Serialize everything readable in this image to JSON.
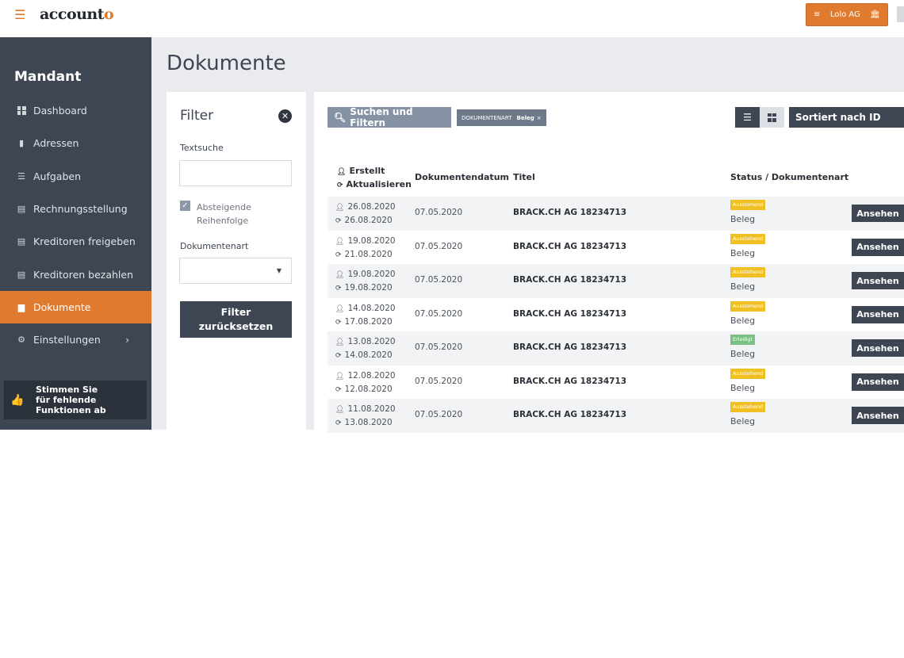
{
  "topbar": {
    "menu_icon": "hamburger-icon",
    "logo_main": "account",
    "logo_accent": "o",
    "client": {
      "label": "Lolo AG",
      "left_icon": "stack-icon",
      "right_icon": "bank-icon"
    }
  },
  "sidebar": {
    "title": "Mandant",
    "items": [
      {
        "label": "Dashboard",
        "icon": "dashboard-icon"
      },
      {
        "label": "Adressen",
        "icon": "address-book-icon"
      },
      {
        "label": "Aufgaben",
        "icon": "list-icon"
      },
      {
        "label": "Rechnungsstellung",
        "icon": "invoice-icon"
      },
      {
        "label": "Kreditoren freigeben",
        "icon": "invoice-icon"
      },
      {
        "label": "Kreditoren bezahlen",
        "icon": "invoice-icon"
      },
      {
        "label": "Dokumente",
        "icon": "inbox-icon",
        "active": true
      },
      {
        "label": "Einstellungen",
        "icon": "gear-icon",
        "chevron": "›"
      }
    ],
    "vote": {
      "line1": "Stimmen Sie",
      "line2": "für fehlende",
      "line3": "Funktionen ab"
    }
  },
  "page": {
    "title": "Dokumente"
  },
  "filter": {
    "title": "Filter",
    "close_symbol": "✕",
    "text_search_label": "Textsuche",
    "text_search_value": "",
    "checkbox_checked": true,
    "checkbox_label_1": "Absteigende",
    "checkbox_label_2": "Reihenfolge",
    "doctype_label": "Dokumentenart",
    "doctype_value": "",
    "reset_line1": "Filter",
    "reset_line2": "zurücksetzen"
  },
  "toolbar": {
    "search_label": "Suchen und Filtern",
    "chip_key": "DOKUMENTENART",
    "chip_value": "Beleg",
    "chip_remove": "×",
    "sort_label": "Sortiert nach ID"
  },
  "table": {
    "headers": {
      "created": "Erstellt",
      "updated": "Aktualisieren",
      "docdate": "Dokumentendatum",
      "title": "Titel",
      "status": "Status / Dokumentenart"
    },
    "rows": [
      {
        "created": "26.08.2020",
        "updated": "26.08.2020",
        "docdate": "07.05.2020",
        "title": "BRACK.CH AG 18234713",
        "status": "Ausstehend",
        "status_color": "#f0c023",
        "doctype": "Beleg",
        "action": "Ansehen"
      },
      {
        "created": "19.08.2020",
        "updated": "21.08.2020",
        "docdate": "07.05.2020",
        "title": "BRACK.CH AG 18234713",
        "status": "Ausstehend",
        "status_color": "#f0c023",
        "doctype": "Beleg",
        "action": "Ansehen"
      },
      {
        "created": "19.08.2020",
        "updated": "19.08.2020",
        "docdate": "07.05.2020",
        "title": "BRACK.CH AG 18234713",
        "status": "Ausstehend",
        "status_color": "#f0c023",
        "doctype": "Beleg",
        "action": "Ansehen"
      },
      {
        "created": "14.08.2020",
        "updated": "17.08.2020",
        "docdate": "07.05.2020",
        "title": "BRACK.CH AG 18234713",
        "status": "Ausstehend",
        "status_color": "#f0c023",
        "doctype": "Beleg",
        "action": "Ansehen"
      },
      {
        "created": "13.08.2020",
        "updated": "14.08.2020",
        "docdate": "07.05.2020",
        "title": "BRACK.CH AG 18234713",
        "status": "Erledigt",
        "status_color": "#7cbf82",
        "doctype": "Beleg",
        "action": "Ansehen"
      },
      {
        "created": "12.08.2020",
        "updated": "12.08.2020",
        "docdate": "07.05.2020",
        "title": "BRACK.CH AG 18234713",
        "status": "Ausstehend",
        "status_color": "#f0c023",
        "doctype": "Beleg",
        "action": "Ansehen"
      },
      {
        "created": "11.08.2020",
        "updated": "13.08.2020",
        "docdate": "07.05.2020",
        "title": "BRACK.CH AG 18234713",
        "status": "Ausstehend",
        "status_color": "#f0c023",
        "doctype": "Beleg",
        "action": "Ansehen"
      }
    ]
  },
  "colors": {
    "accent": "#e07a2f",
    "sidebar": "#3e4653",
    "pending": "#f0c023",
    "done": "#7cbf82"
  }
}
